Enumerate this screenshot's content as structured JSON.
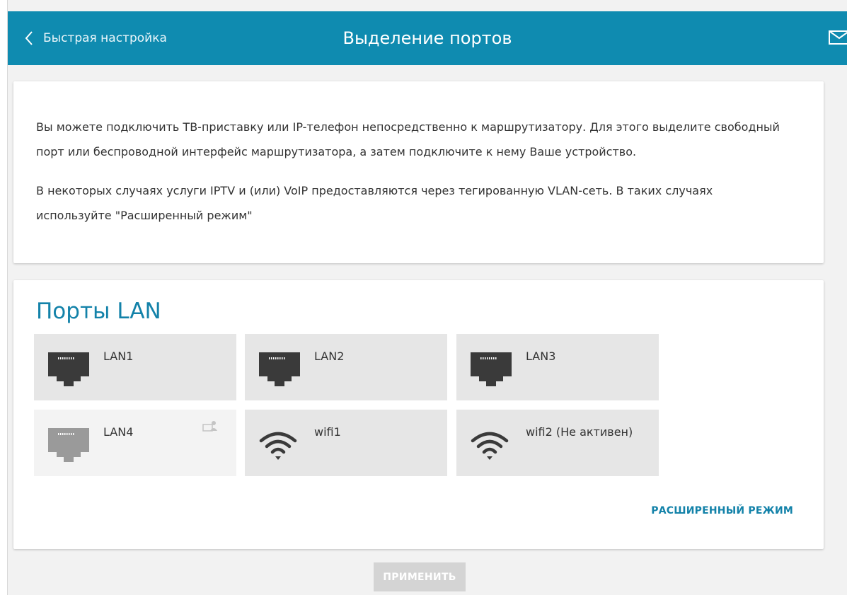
{
  "header": {
    "back_label": "Быстрая настройка",
    "title": "Выделение портов"
  },
  "info": {
    "paragraph1": "Вы можете подключить ТВ-приставку или IP-телефон непосредственно к маршрутизатору. Для этого выделите свободный порт или беспроводной интерфейс маршрутизатора, а затем подключите к нему Ваше устройство.",
    "paragraph2": "В некоторых случаях услуги IPTV и (или) VoIP предоставляются через тегированную VLAN-сеть. В таких случаях используйте \"Расширенный режим\""
  },
  "ports": {
    "title": "Порты LAN",
    "items": [
      {
        "label": "LAN1",
        "icon": "ethernet-port-icon",
        "state": "available"
      },
      {
        "label": "LAN2",
        "icon": "ethernet-port-icon",
        "state": "available"
      },
      {
        "label": "LAN3",
        "icon": "ethernet-port-icon",
        "state": "available"
      },
      {
        "label": "LAN4",
        "icon": "ethernet-port-icon",
        "state": "used-by-user"
      },
      {
        "label": "wifi1",
        "icon": "wifi-icon",
        "state": "available"
      },
      {
        "label": "wifi2 (Не активен)",
        "icon": "wifi-icon",
        "state": "available"
      }
    ],
    "advanced_label": "РАСШИРЕННЫЙ РЕЖИМ"
  },
  "apply_label": "ПРИМЕНИТЬ",
  "colors": {
    "header_bg": "#0f8bb0",
    "accent": "#1382a9",
    "tile_bg": "#e6e6e6",
    "tile_disabled_bg": "#f3f3f3",
    "apply_disabled_bg": "#d4d4d4"
  }
}
